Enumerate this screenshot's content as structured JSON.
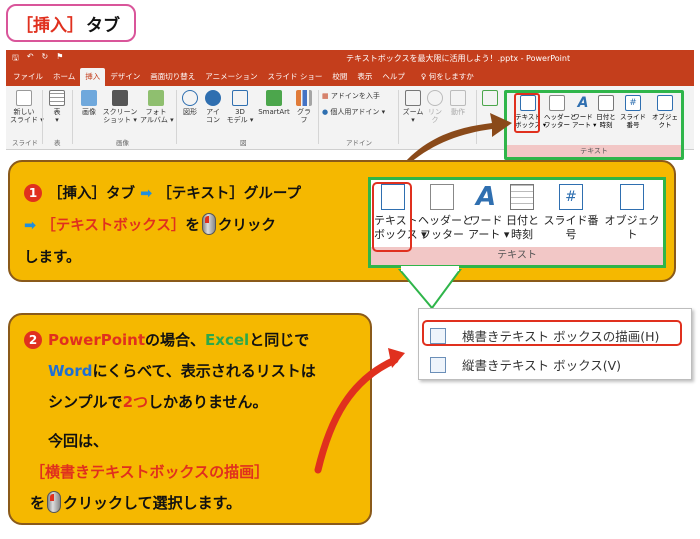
{
  "title": {
    "highlight": "［挿入］",
    "rest": "タブ"
  },
  "ppt": {
    "quick_access": [
      "🖫",
      "↶",
      "↻",
      "⚑"
    ],
    "document_title": "テキストボックスを最大限に活用しよう！.pptx - PowerPoint",
    "tabs": [
      "ファイル",
      "ホーム",
      "挿入",
      "デザイン",
      "画面切り替え",
      "アニメーション",
      "スライド ショー",
      "校閲",
      "表示",
      "ヘルプ"
    ],
    "tell_me": "♀ 何をしますか",
    "ribbon": {
      "new_slide": "新しい\nスライド ▾",
      "table": "表\n▾",
      "image": "画像",
      "screenshot": "スクリーン\nショット ▾",
      "photo_album": "フォト\nアルバム ▾",
      "shapes": "図形",
      "icons": "アイ\nコン",
      "model3d": "3D\nモデル ▾",
      "smartart": "SmartArt",
      "graph": "グラフ",
      "get_addins": "アドインを入手",
      "personal_addins": "個人用アドイン ▾",
      "zoom": "ズーム\n▾",
      "link": "リン\nク",
      "action": "動作",
      "textbox": "テキスト\nボックス ▾",
      "header_footer": "ヘッダーと\nフッター",
      "wordart": "ワード\nアート ▾",
      "datetime": "日付と\n時刻",
      "slide_number": "スライド番号",
      "object": "オブジェクト",
      "groups": {
        "slide": "スライド",
        "table": "表",
        "image": "画像",
        "figure": "図",
        "addin": "アドイン",
        "text": "テキスト"
      }
    }
  },
  "step1": {
    "num": "1",
    "line1a": "［挿入］タブ ",
    "arrow": "➡",
    "line1b": " ［テキスト］グループ",
    "line2red": "［テキストボックス］",
    "line2rest": "を",
    "click": "クリック",
    "line3": "します。"
  },
  "zoom": {
    "textbox": "テキスト\nボックス ▾",
    "header_footer": "ヘッダーと\nフッター",
    "wordart": "ワード\nアート ▾",
    "datetime": "日付と\n時刻",
    "slide_number": "スライド番号",
    "object": "オブジェクト",
    "group_label": "テキスト"
  },
  "step2": {
    "num": "2",
    "l1a": "PowerPoint",
    "l1b": "の場合、",
    "l1c": "Excel",
    "l1d": "と同じで",
    "l2a": "Word",
    "l2b": "にくらべて、表示されるリストは",
    "l3a": "シンプルで",
    "l3b": "2つ",
    "l3c": "しかありません。",
    "l4": "今回は、",
    "l5": "［横書きテキストボックスの描画］",
    "l6a": "を",
    "l6b": "クリックして選択します。"
  },
  "dropdown": {
    "item1": "横書きテキスト ボックスの描画(H)",
    "item2": "縦書きテキスト ボックス(V)"
  }
}
